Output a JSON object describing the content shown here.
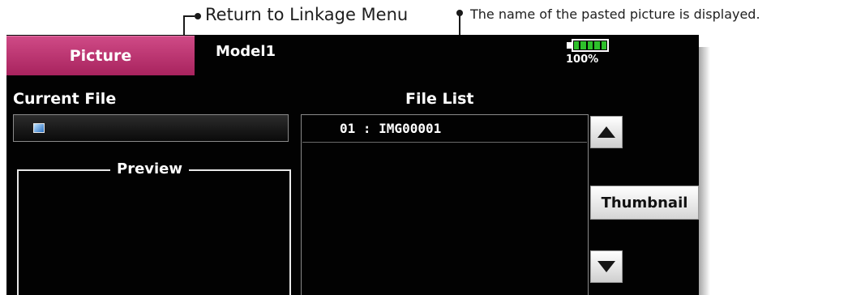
{
  "annotations": {
    "return_menu": "Return to Linkage Menu",
    "picture_name": "The name of the pasted picture is displayed."
  },
  "header": {
    "tab_label": "Picture",
    "model_name": "Model1",
    "battery_percent": "100%"
  },
  "current_file": {
    "label": "Current File",
    "icon": "image-file-icon"
  },
  "preview": {
    "label": "Preview"
  },
  "file_list": {
    "label": "File List",
    "items": [
      "01 : IMG00001"
    ]
  },
  "buttons": {
    "thumbnail": "Thumbnail",
    "scroll_up_icon": "triangle-up-icon",
    "scroll_down_icon": "triangle-down-icon"
  },
  "colors": {
    "tab_accent": "#b8316e",
    "battery_green": "#2ec12b",
    "screen_bg": "#020202"
  }
}
